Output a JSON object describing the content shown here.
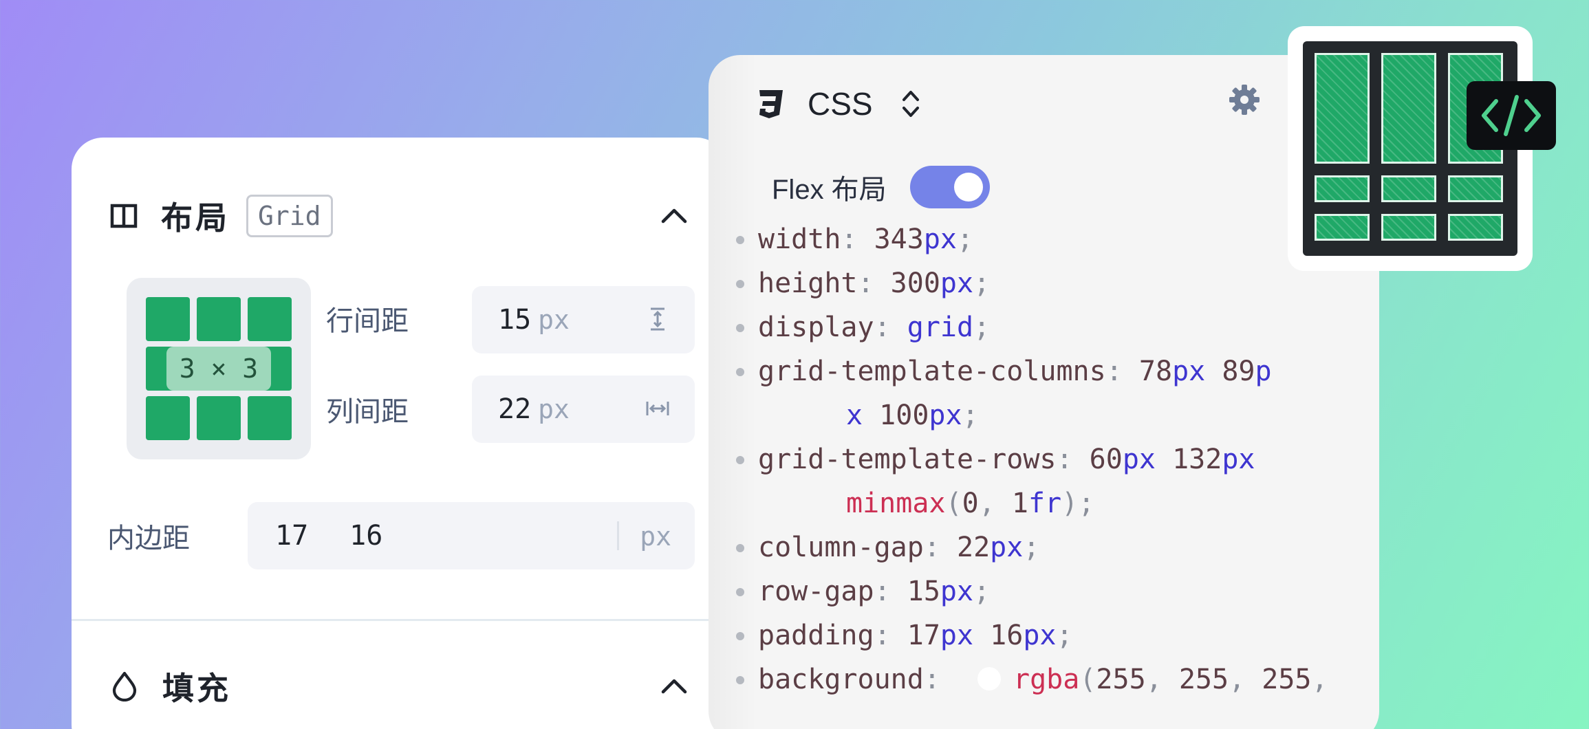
{
  "colors": {
    "accent": "#7583e8",
    "grid_green": "#1fa867",
    "code_unit": "#3e35d0",
    "code_function": "#cc2f53"
  },
  "layout_panel": {
    "title": "布局",
    "badge": "Grid",
    "icon": "columns-icon",
    "preview_label": "3 × 3",
    "row_gap": {
      "label": "行间距",
      "value": "15",
      "unit": "px",
      "icon": "row-gap-icon"
    },
    "column_gap": {
      "label": "列间距",
      "value": "22",
      "unit": "px",
      "icon": "column-gap-icon"
    },
    "padding": {
      "label": "内边距",
      "values": [
        "17",
        "16"
      ],
      "unit": "px"
    }
  },
  "fill_panel": {
    "title": "填充",
    "icon": "droplet-icon"
  },
  "css_panel": {
    "title": "CSS",
    "icon": "css3-icon",
    "flex_label": "Flex 布局",
    "flex_enabled": true,
    "code_lines": [
      {
        "prop": "width",
        "value": [
          [
            "343",
            "n"
          ],
          [
            "px",
            "u"
          ]
        ]
      },
      {
        "prop": "height",
        "value": [
          [
            "300",
            "n"
          ],
          [
            "px",
            "u"
          ]
        ]
      },
      {
        "prop": "display",
        "value": [
          [
            "grid",
            "u"
          ]
        ]
      },
      {
        "prop": "grid-template-columns",
        "value": [
          [
            "    78",
            "n"
          ],
          [
            "px",
            "u"
          ],
          [
            " 89",
            "n"
          ],
          [
            "p",
            "u"
          ]
        ],
        "continuation": [
          [
            "x",
            "u"
          ],
          [
            " 100",
            "n"
          ],
          [
            "px",
            "u"
          ],
          [
            ";",
            "p"
          ]
        ]
      },
      {
        "prop": "grid-template-rows",
        "value": [
          [
            "    60",
            "n"
          ],
          [
            "px",
            "u"
          ],
          [
            " 132",
            "n"
          ],
          [
            "px",
            "u"
          ]
        ],
        "continuation": [
          [
            "minmax",
            "f"
          ],
          [
            "(",
            "p"
          ],
          [
            "0",
            "n"
          ],
          [
            ", ",
            "p"
          ],
          [
            "1",
            "n"
          ],
          [
            "fr",
            "u"
          ],
          [
            ");",
            "p"
          ]
        ]
      },
      {
        "prop": "column-gap",
        "value": [
          [
            "22",
            "n"
          ],
          [
            "px",
            "u"
          ]
        ]
      },
      {
        "prop": "row-gap",
        "value": [
          [
            "15",
            "n"
          ],
          [
            "px",
            "u"
          ]
        ]
      },
      {
        "prop": "padding",
        "value": [
          [
            "17",
            "n"
          ],
          [
            "px",
            "u"
          ],
          [
            " 16",
            "n"
          ],
          [
            "px",
            "u"
          ]
        ]
      },
      {
        "prop": "background",
        "swatch": "#ffffff",
        "value": [
          [
            "rgba",
            "f"
          ],
          [
            "(",
            "p"
          ],
          [
            "255",
            "n"
          ],
          [
            ", ",
            "p"
          ],
          [
            "255",
            "n"
          ],
          [
            ", ",
            "p"
          ],
          [
            "255",
            "n"
          ],
          [
            ",",
            "p"
          ]
        ],
        "no_semicolon": true
      }
    ]
  }
}
